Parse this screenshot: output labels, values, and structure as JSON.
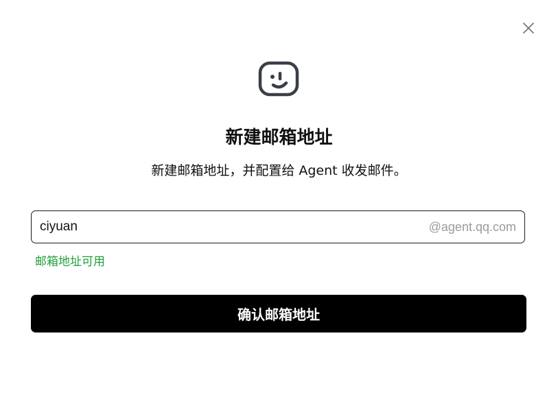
{
  "dialog": {
    "close_icon": "close-icon",
    "logo_icon": "smiley-face-icon",
    "title": "新建邮箱地址",
    "subtitle": "新建邮箱地址，并配置给 Agent 收发邮件。",
    "email_input": {
      "value": "ciyuan",
      "placeholder": "",
      "domain_suffix": "@agent.qq.com"
    },
    "status_text": "邮箱地址可用",
    "confirm_label": "确认邮箱地址"
  },
  "colors": {
    "status": "#22a03a",
    "button_bg": "#000000",
    "button_text": "#ffffff",
    "suffix_text": "#9a9a9a",
    "icon_stroke": "#3a3f47"
  }
}
